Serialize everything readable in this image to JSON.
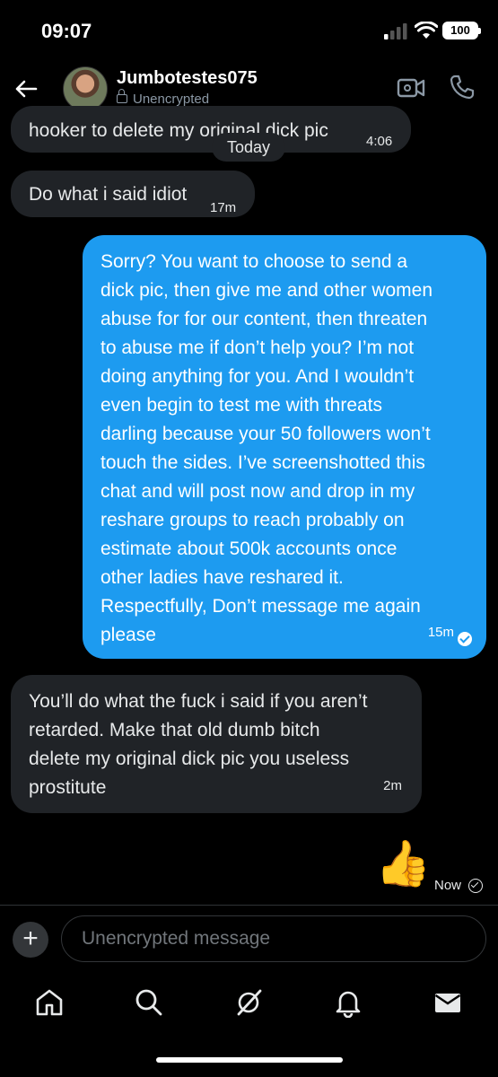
{
  "status_bar": {
    "time": "09:07",
    "battery": "100"
  },
  "header": {
    "name": "Jumbotestes075",
    "encryption": "Unencrypted"
  },
  "date_separator": "Today",
  "messages": [
    {
      "direction": "received",
      "text": "hooker to delete my original dick pic",
      "time": "4:06"
    },
    {
      "direction": "received",
      "text": "Do what i said idiot",
      "time": "17m"
    },
    {
      "direction": "sent",
      "text": "Sorry? You want to choose to send a\ndick pic, then give me and other women\nabuse for for our content, then threaten\nto abuse me if don’t help you? I’m not\ndoing anything for you. And I wouldn’t\neven begin to test me with threats\ndarling because your 50 followers won’t\ntouch the sides. I’ve screenshotted this\nchat and will post now and drop in my\nreshare groups to reach probably on\nestimate about 500k accounts once\nother ladies have reshared it.\nRespectfully, Don’t message me again\nplease",
      "time": "15m",
      "status": "read"
    },
    {
      "direction": "received",
      "text": "You’ll do what the fuck i said if you aren’t\nretarded. Make that old dumb bitch\ndelete my original dick pic you useless\nprostitute",
      "time": "2m"
    },
    {
      "direction": "sent",
      "text": "👍",
      "time": "Now",
      "status": "sent"
    }
  ],
  "composer": {
    "placeholder": "Unencrypted message"
  },
  "tabbar": {
    "tabs": [
      "home-icon",
      "search-icon",
      "grok-icon",
      "notifications-icon",
      "messages-icon"
    ]
  },
  "colors": {
    "accent": "#1d9bf0",
    "received_bubble": "#202327",
    "background": "#000000"
  }
}
